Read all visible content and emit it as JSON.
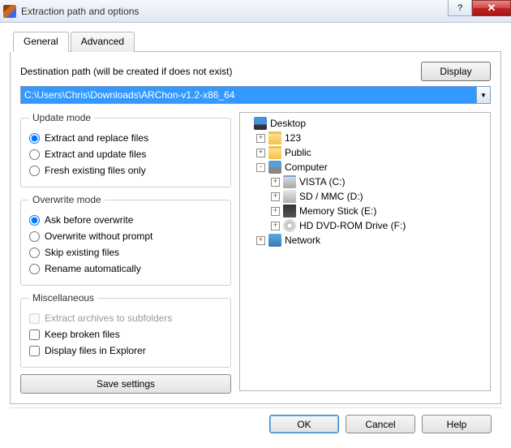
{
  "title": "Extraction path and options",
  "tabs": {
    "general": "General",
    "advanced": "Advanced"
  },
  "destination": {
    "label": "Destination path (will be created if does not exist)",
    "display_btn": "Display",
    "path": "C:\\Users\\Chris\\Downloads\\ARChon-v1.2-x86_64"
  },
  "update_mode": {
    "legend": "Update mode",
    "opt1": "Extract and replace files",
    "opt2": "Extract and update files",
    "opt3": "Fresh existing files only"
  },
  "overwrite_mode": {
    "legend": "Overwrite mode",
    "opt1": "Ask before overwrite",
    "opt2": "Overwrite without prompt",
    "opt3": "Skip existing files",
    "opt4": "Rename automatically"
  },
  "misc": {
    "legend": "Miscellaneous",
    "opt1": "Extract archives to subfolders",
    "opt2": "Keep broken files",
    "opt3": "Display files in Explorer"
  },
  "save_btn": "Save settings",
  "tree": {
    "desktop": "Desktop",
    "n123": "123",
    "public": "Public",
    "computer": "Computer",
    "vista": "VISTA (C:)",
    "sd": "SD / MMC (D:)",
    "ms": "Memory Stick (E:)",
    "dvd": "HD DVD-ROM Drive (F:)",
    "network": "Network"
  },
  "footer": {
    "ok": "OK",
    "cancel": "Cancel",
    "help": "Help"
  }
}
